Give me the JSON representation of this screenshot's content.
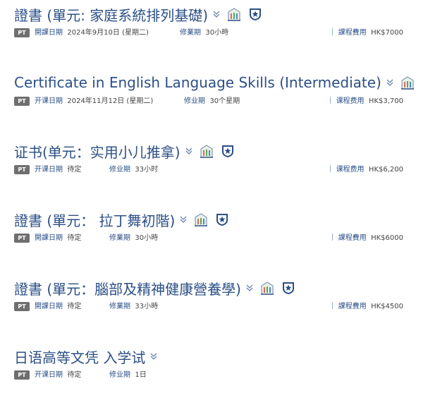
{
  "courses": [
    {
      "title": "證書 (單元: 家庭系統排列基礎)",
      "badge": "PT",
      "start_label": "開課日期",
      "start_value": "2024年9月10日 (星期二)",
      "period_label": "修業期",
      "period_value": "30小時",
      "fee_label": "課程費用",
      "fee_value": "HK$7000",
      "icons": [
        "building-icon",
        "shield-star-icon"
      ]
    },
    {
      "title": "Certificate in English Language Skills (Intermediate)",
      "badge": "PT",
      "start_label": "开课日期",
      "start_value": "2024年11月12日 (星期二)",
      "period_label": "修业期",
      "period_value": "30个星期",
      "fee_label": "课程费用",
      "fee_value": "HK$3,700",
      "icons": [
        "building-icon"
      ]
    },
    {
      "title": "证书(单元：实用小儿推拿)",
      "badge": "PT",
      "start_label": "开课日期",
      "start_value": "待定",
      "period_label": "修业期",
      "period_value": "33小时",
      "fee_label": "课程费用",
      "fee_value": "HK$6,200",
      "icons": [
        "building-icon",
        "shield-star-icon"
      ]
    },
    {
      "title": "證書 (單元： 拉丁舞初階)",
      "badge": "PT",
      "start_label": "開課日期",
      "start_value": "待定",
      "period_label": "修業期",
      "period_value": "30小時",
      "fee_label": "課程費用",
      "fee_value": "HK$6000",
      "icons": [
        "building-icon",
        "shield-star-icon"
      ]
    },
    {
      "title": "證書 (單元：腦部及精神健康營養學)",
      "badge": "PT",
      "start_label": "開課日期",
      "start_value": "待定",
      "period_label": "修業期",
      "period_value": "33小時",
      "fee_label": "課程費用",
      "fee_value": "HK$4500",
      "icons": [
        "building-icon",
        "shield-star-icon"
      ]
    },
    {
      "title": "日语高等文凭 入学试",
      "badge": "PT",
      "start_label": "开课日期",
      "start_value": "待定",
      "period_label": "修业期",
      "period_value": "1日",
      "fee_label": "",
      "fee_value": "",
      "icons": []
    }
  ],
  "colors": {
    "title": "#2b4f86",
    "badge": "#6f6f6f",
    "shield": "#2b4f86"
  }
}
